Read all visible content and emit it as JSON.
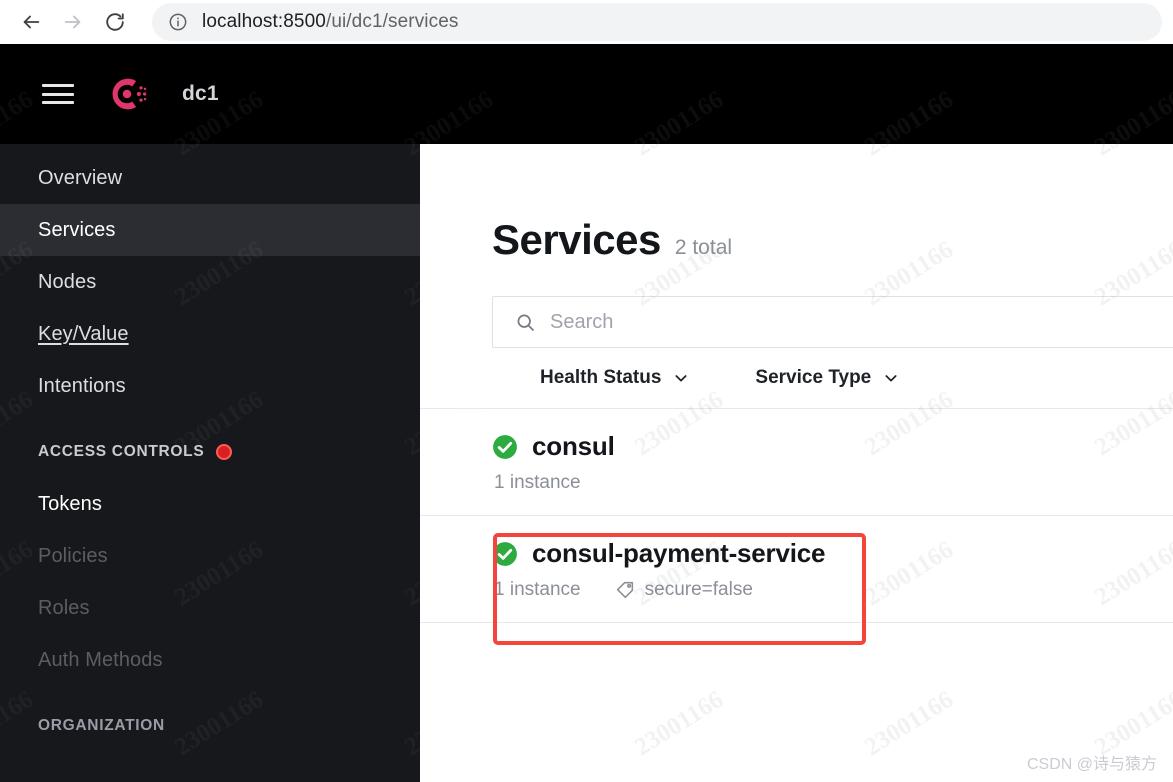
{
  "browser": {
    "back_icon": "arrow-left-icon",
    "forward_icon": "arrow-right-icon",
    "reload_icon": "reload-icon",
    "info_icon": "info-circle-icon",
    "url_host": "localhost:8500",
    "url_path": "/ui/dc1/services",
    "url_full": "localhost:8500/ui/dc1/services"
  },
  "header": {
    "menu_icon": "hamburger-menu-icon",
    "logo_icon": "consul-logo-icon",
    "datacenter": "dc1"
  },
  "sidebar": {
    "items": [
      {
        "label": "Overview",
        "state": "normal"
      },
      {
        "label": "Services",
        "state": "active"
      },
      {
        "label": "Nodes",
        "state": "normal"
      },
      {
        "label": "Key/Value",
        "state": "hovered"
      },
      {
        "label": "Intentions",
        "state": "normal"
      }
    ],
    "sections": [
      {
        "title": "ACCESS CONTROLS",
        "badge": "alert-dot-icon",
        "items": [
          {
            "label": "Tokens",
            "state": "bright"
          },
          {
            "label": "Policies",
            "state": "muted"
          },
          {
            "label": "Roles",
            "state": "muted"
          },
          {
            "label": "Auth Methods",
            "state": "muted"
          }
        ]
      },
      {
        "title": "ORGANIZATION",
        "items": []
      }
    ]
  },
  "main": {
    "title": "Services",
    "count_label": "2 total",
    "search": {
      "icon": "search-icon",
      "placeholder": "Search",
      "value": ""
    },
    "filters": [
      {
        "label": "Health Status",
        "icon": "chevron-down-icon"
      },
      {
        "label": "Service Type",
        "icon": "chevron-down-icon"
      }
    ],
    "services": [
      {
        "name": "consul",
        "status_icon": "check-circle-icon",
        "instances": "1 instance",
        "tags": []
      },
      {
        "name": "consul-payment-service",
        "status_icon": "check-circle-icon",
        "instances": "1 instance",
        "tags": [
          {
            "icon": "tag-icon",
            "text": "secure=false"
          }
        ],
        "highlighted": true
      }
    ]
  },
  "annotation": {
    "color": "#f4453c",
    "target": "consul-payment-service"
  },
  "watermark": {
    "tile_text": "23001166",
    "footer_text": "CSDN @诗与猿方"
  },
  "colors": {
    "accent_pink": "#e0366b",
    "status_green": "#2eab40",
    "annotation_red": "#f4453c",
    "alert_red": "#d62121",
    "sidebar_bg": "#17181c",
    "header_bg": "#000000"
  }
}
